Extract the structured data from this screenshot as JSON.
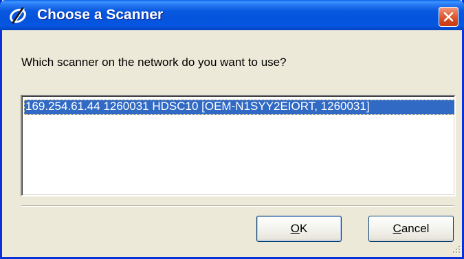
{
  "window": {
    "title": "Choose a Scanner",
    "title_bar_color": "#0a5ae0",
    "close_button_color": "#d5471e",
    "icons": {
      "app": "scanner-app-icon",
      "close": "close-icon",
      "grip": "resize-grip-icon"
    }
  },
  "prompt": "Which scanner on the network do you want to use?",
  "scanner_list": {
    "items": [
      {
        "label": "169.254.61.44  1260031  HDSC10  [OEM-N1SYY2EIORT, 1260031]",
        "selected": true
      }
    ],
    "selection_color": "#316ac5"
  },
  "buttons": {
    "ok": {
      "accel": "O",
      "rest": "K"
    },
    "cancel": {
      "accel": "C",
      "rest": "ancel"
    }
  }
}
